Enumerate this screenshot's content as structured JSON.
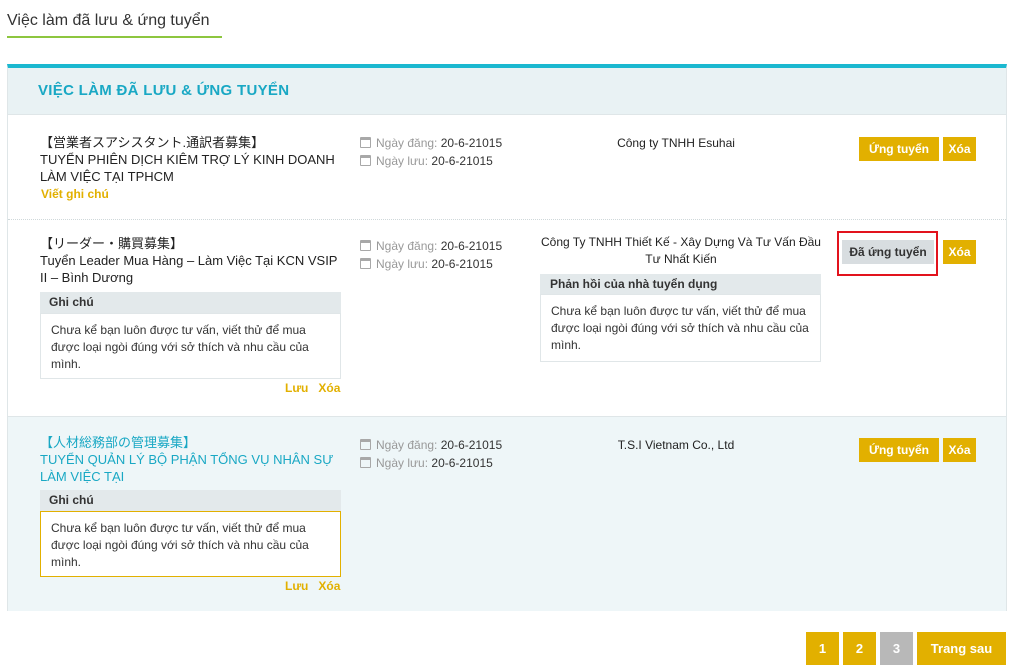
{
  "page": {
    "heading": "Việc làm đã lưu & ứng tuyển"
  },
  "panel": {
    "title": "VIỆC LÀM ĐÃ LƯU & ỨNG TUYỂN"
  },
  "labels": {
    "posted": "Ngày đăng:",
    "saved": "Ngày lưu:",
    "note_header": "Ghi chú",
    "feedback_header": "Phản hồi của nhà tuyển dụng",
    "save": "Lưu",
    "delete": "Xóa",
    "apply": "Ứng tuyển",
    "applied": "Đã ứng tuyển",
    "write_note": "Viết ghi chú"
  },
  "jobs": [
    {
      "title_jp": "【営業者スアシスタント.通訳者募集】",
      "title": "TUYỂN PHIÊN DỊCH KIÊM TRỢ LÝ KINH DOANH LÀM VIỆC TẠI TPHCM",
      "posted": "20-6-21015",
      "saved": "20-6-21015",
      "company": "Công ty TNHH Esuhai"
    },
    {
      "title_jp": "【リーダー・購買募集】",
      "title": "Tuyển Leader Mua Hàng – Làm Việc Tại KCN VSIP II – Bình Dương",
      "posted": "20-6-21015",
      "saved": "20-6-21015",
      "company": "Công Ty TNHH Thiết Kế - Xây Dựng Và Tư Vấn Đầu Tư Nhất Kiến",
      "note": "Chưa kể bạn luôn được tư vấn, viết thử để mua được loại ngòi đúng với sở thích và nhu cầu của mình.",
      "feedback": "Chưa kể bạn luôn được tư vấn, viết thử để mua được loại ngòi đúng với sở thích và nhu cầu của mình."
    },
    {
      "title_jp": "【人材総務部の管理募集】",
      "title": "TUYỂN QUẢN LÝ BỘ PHẬN TỔNG VỤ NHÂN SỰ LÀM VIỆC TẠI",
      "posted": "20-6-21015",
      "saved": "20-6-21015",
      "company": "T.S.I Vietnam Co., Ltd",
      "note": "Chưa kể bạn luôn được tư vấn, viết thử để mua được loại ngòi đúng với sở thích và nhu cầu của mình."
    }
  ],
  "pagination": {
    "pages": [
      "1",
      "2",
      "3"
    ],
    "current": "3",
    "next": "Trang sau"
  },
  "colors": {
    "accent": "#e2b000",
    "brand": "#19a8c4",
    "highlight_border": "#e2131d"
  }
}
